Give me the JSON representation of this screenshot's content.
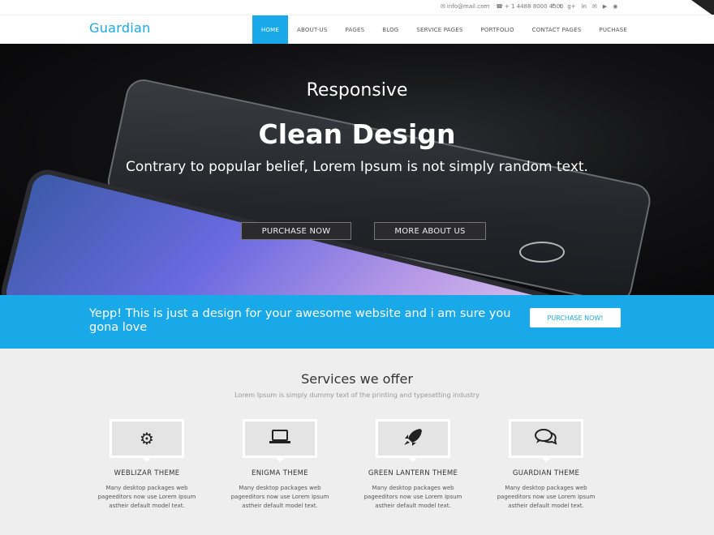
{
  "topbar": {
    "email": "info@mail.com",
    "phone": "+ 1 4488 8000 4500",
    "social_icons": [
      "facebook-icon",
      "twitter-icon",
      "google-plus-icon",
      "linkedin-icon",
      "email-icon",
      "youtube-icon",
      "rss-icon"
    ],
    "social_glyphs": [
      "f",
      "t",
      "g+",
      "in",
      "✉",
      "▶",
      "◉"
    ]
  },
  "header": {
    "logo": "Guardian",
    "nav": [
      {
        "label": "HOME",
        "active": true
      },
      {
        "label": "ABOUT-US"
      },
      {
        "label": "PAGES"
      },
      {
        "label": "BLOG"
      },
      {
        "label": "SERVICE PAGES"
      },
      {
        "label": "PORTFOLIO"
      },
      {
        "label": "CONTACT PAGES"
      },
      {
        "label": "PUCHASE"
      }
    ]
  },
  "hero": {
    "subtitle": "Responsive",
    "title": "Clean Design",
    "description": "Contrary to popular belief, Lorem Ipsum is not simply random text.",
    "button_primary": "PURCHASE NOW",
    "button_secondary": "MORE ABOUT US"
  },
  "cta": {
    "text": "Yepp! This is just a design for your awesome website and i am sure you gona love",
    "button": "PURCHASE NOW!"
  },
  "services": {
    "title": "Services we offer",
    "subtitle": "Lorem Ipsum is simply dummy text of the printing and typesetting industry",
    "items": [
      {
        "icon": "gear-icon",
        "title": "WEBLIZAR THEME",
        "desc": "Many desktop packages web pageeditors now use Lorem Ipsum astheir default model text."
      },
      {
        "icon": "laptop-icon",
        "title": "ENIGMA THEME",
        "desc": "Many desktop packages web pageeditors now use Lorem Ipsum astheir default model text."
      },
      {
        "icon": "rocket-icon",
        "title": "GREEN LANTERN THEME",
        "desc": "Many desktop packages web pageeditors now use Lorem Ipsum astheir default model text."
      },
      {
        "icon": "comments-icon",
        "title": "GUARDIAN THEME",
        "desc": "Many desktop packages web pageeditors now use Lorem Ipsum astheir default model text."
      }
    ]
  },
  "colors": {
    "accent": "#1aa9e8",
    "hero_bg": "#0b0b0d",
    "services_bg": "#eeeeee"
  }
}
